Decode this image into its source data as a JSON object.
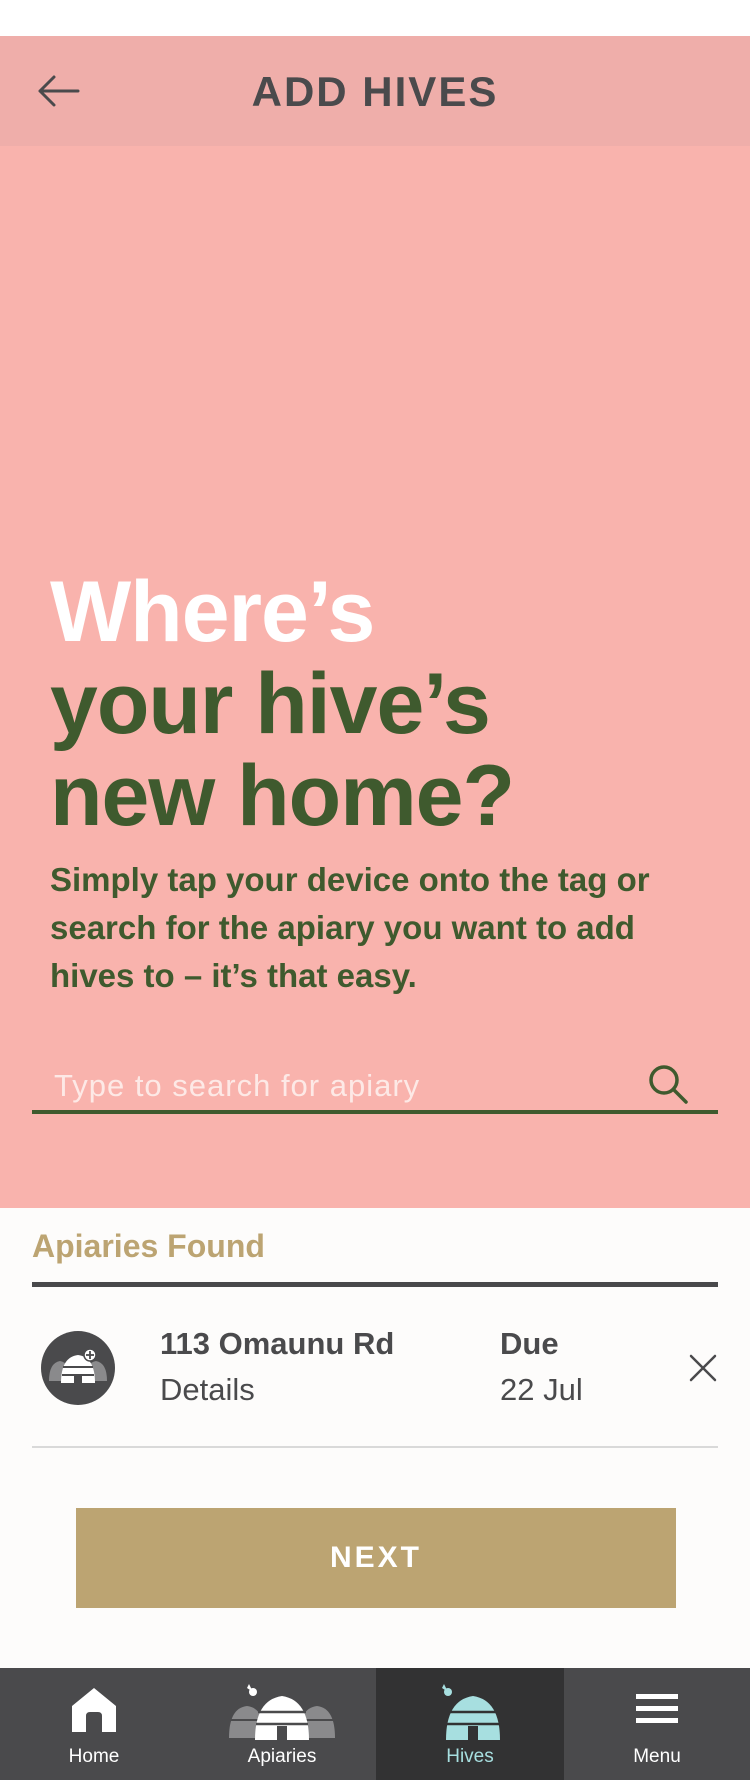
{
  "header": {
    "title": "ADD HIVES"
  },
  "hero": {
    "headline_line1": "Where’s",
    "headline_line2": "your hive’s",
    "headline_line3": "new home?",
    "subtext": "Simply tap your device onto the tag or search for the apiary you want to add hives to – it’s that easy.",
    "search_placeholder": "Type to search for apiary",
    "search_value": ""
  },
  "results": {
    "title": "Apiaries Found",
    "items": [
      {
        "name": "113 Omaunu Rd",
        "details_label": "Details",
        "due_label": "Due",
        "due_date": "22 Jul"
      }
    ]
  },
  "actions": {
    "next_label": "NEXT"
  },
  "nav": {
    "items": [
      {
        "label": "Home",
        "icon": "home-icon",
        "active": false
      },
      {
        "label": "Apiaries",
        "icon": "apiaries-icon",
        "active": false
      },
      {
        "label": "Hives",
        "icon": "hive-icon",
        "active": true
      },
      {
        "label": "Menu",
        "icon": "menu-icon",
        "active": false
      }
    ]
  },
  "colors": {
    "header_bg": "#efaeaa",
    "hero_bg": "#f9b3ad",
    "headline_green": "#3f5a2e",
    "accent_gold": "#bca472",
    "nav_bg": "#4a4a4c",
    "nav_active_bg": "#323233",
    "nav_active_label": "#a7dfe0"
  }
}
